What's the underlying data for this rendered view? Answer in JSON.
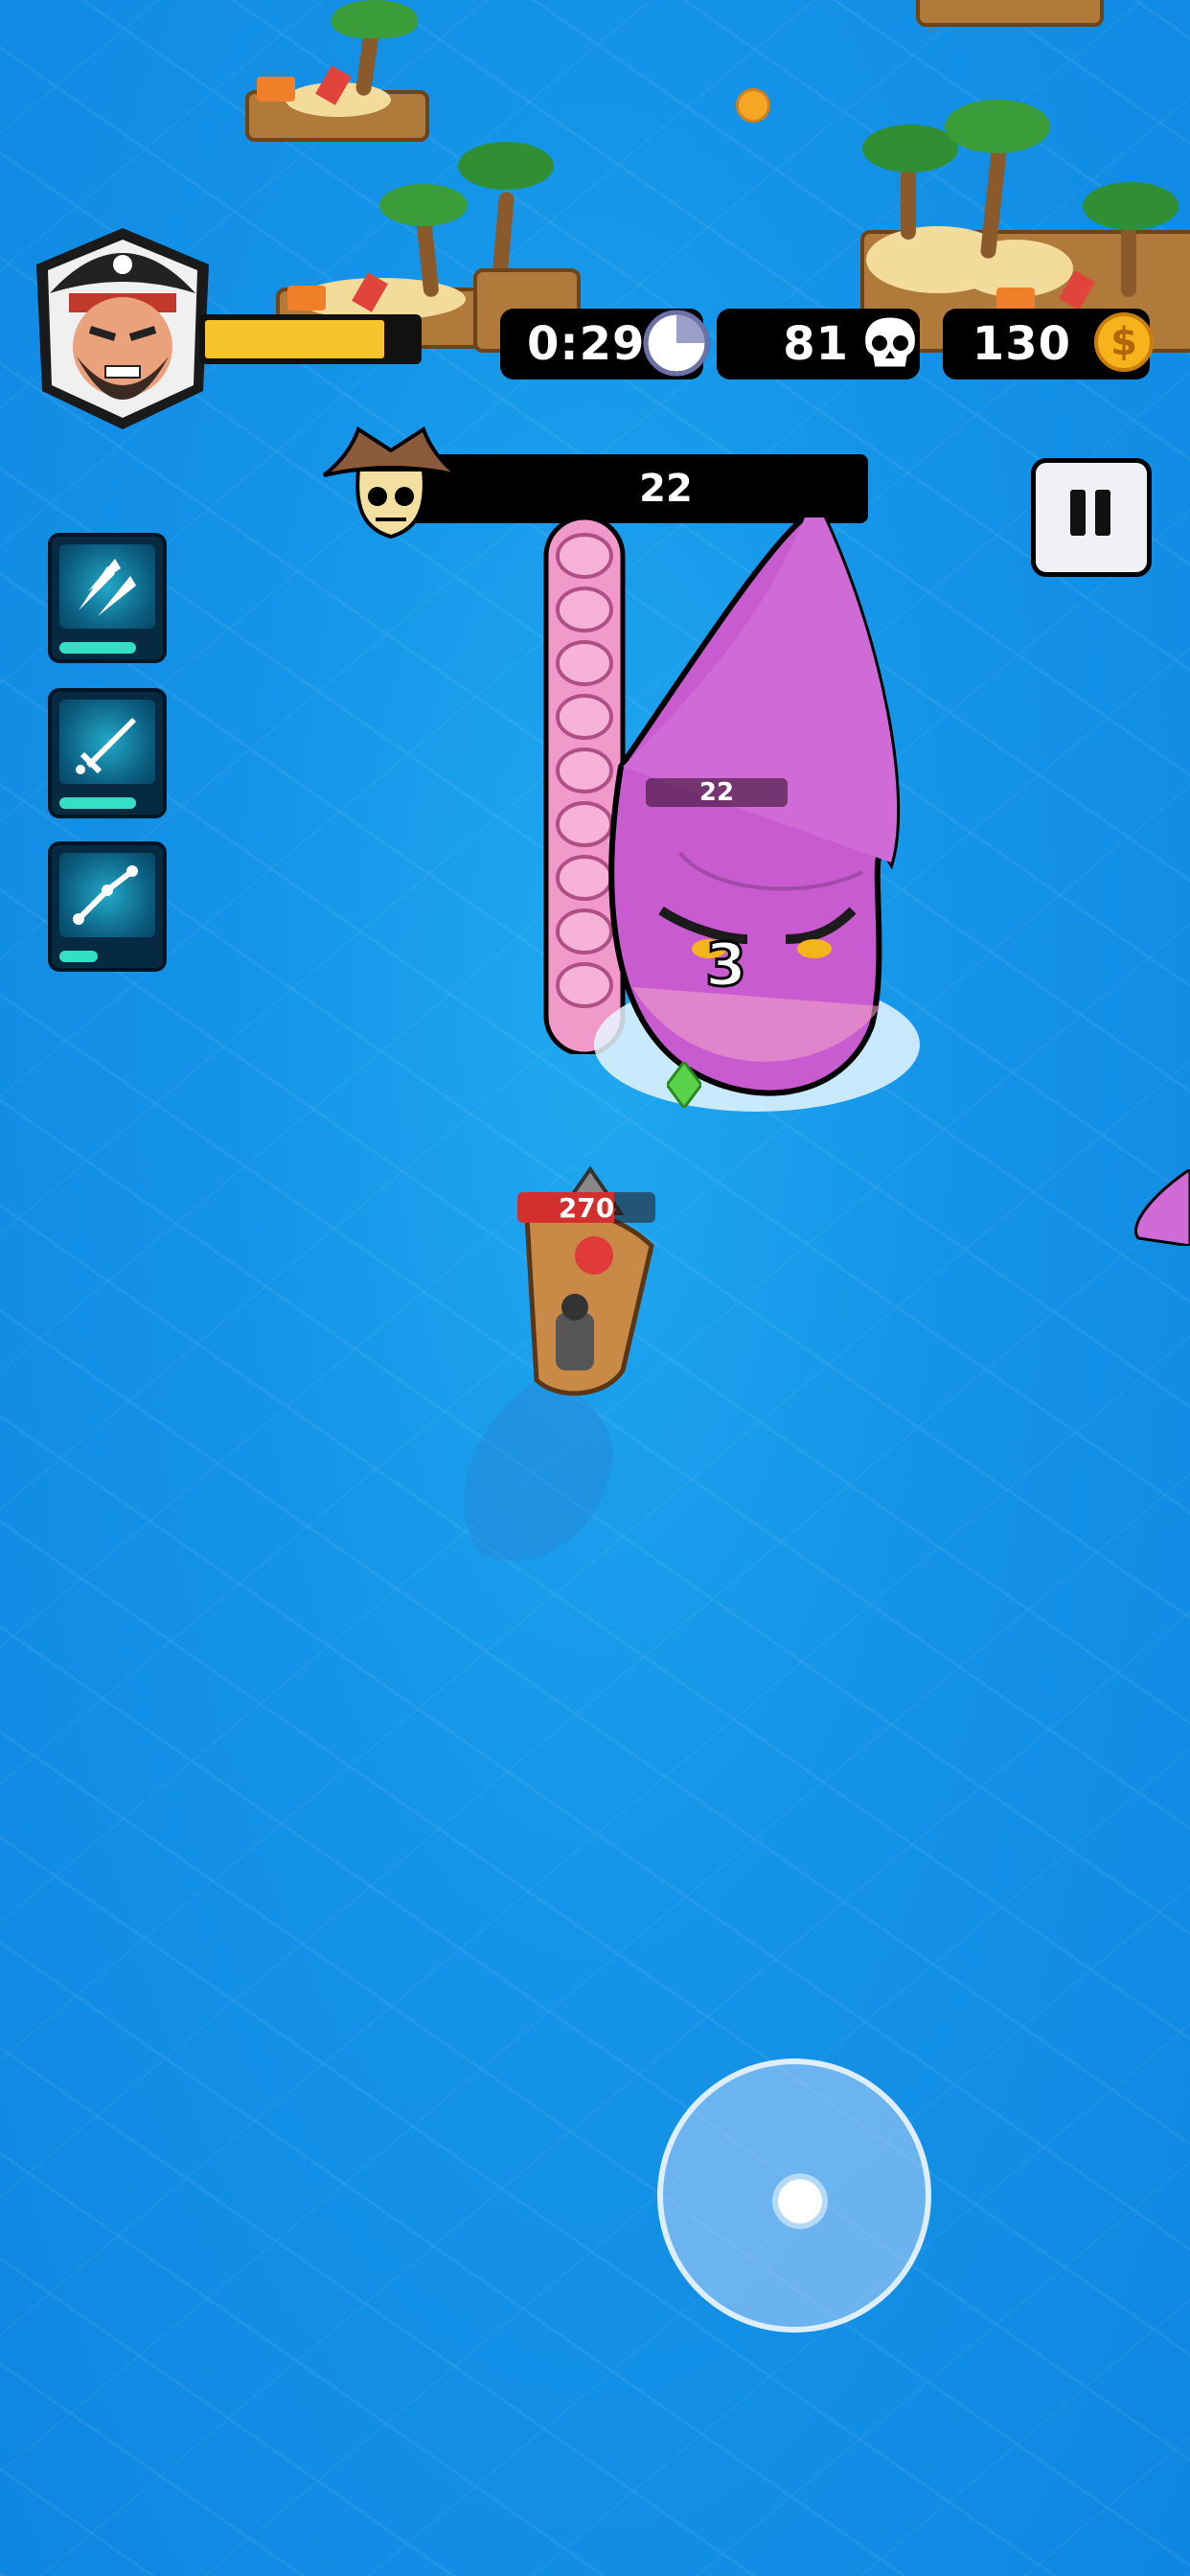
{
  "hud": {
    "timer": "0:29",
    "kills": "81",
    "coins": "130",
    "player_health_fraction": 0.85,
    "clock_icon": "clock-icon",
    "skull_icon": "skull-icon",
    "coin_icon": "coin-icon",
    "coin_symbol": "$"
  },
  "boss": {
    "health_label": "22",
    "overhead_health_label": "22",
    "damage_popup": "3",
    "icon": "pirate-skull-hat-icon"
  },
  "player_boat": {
    "health_label": "270"
  },
  "skills": [
    {
      "name": "rockets",
      "icon": "rockets-icon",
      "cooldown_fraction": 0.8
    },
    {
      "name": "sword",
      "icon": "sword-icon",
      "cooldown_fraction": 0.8
    },
    {
      "name": "chain",
      "icon": "chain-icon",
      "cooldown_fraction": 0.4
    }
  ],
  "controls": {
    "pause_icon": "pause-icon",
    "joystick": "virtual-joystick"
  },
  "colors": {
    "ocean": "#1493e8",
    "squid": "#c95bd0",
    "health_yellow": "#f7c52b",
    "skill_cooldown": "#33e0c6"
  }
}
